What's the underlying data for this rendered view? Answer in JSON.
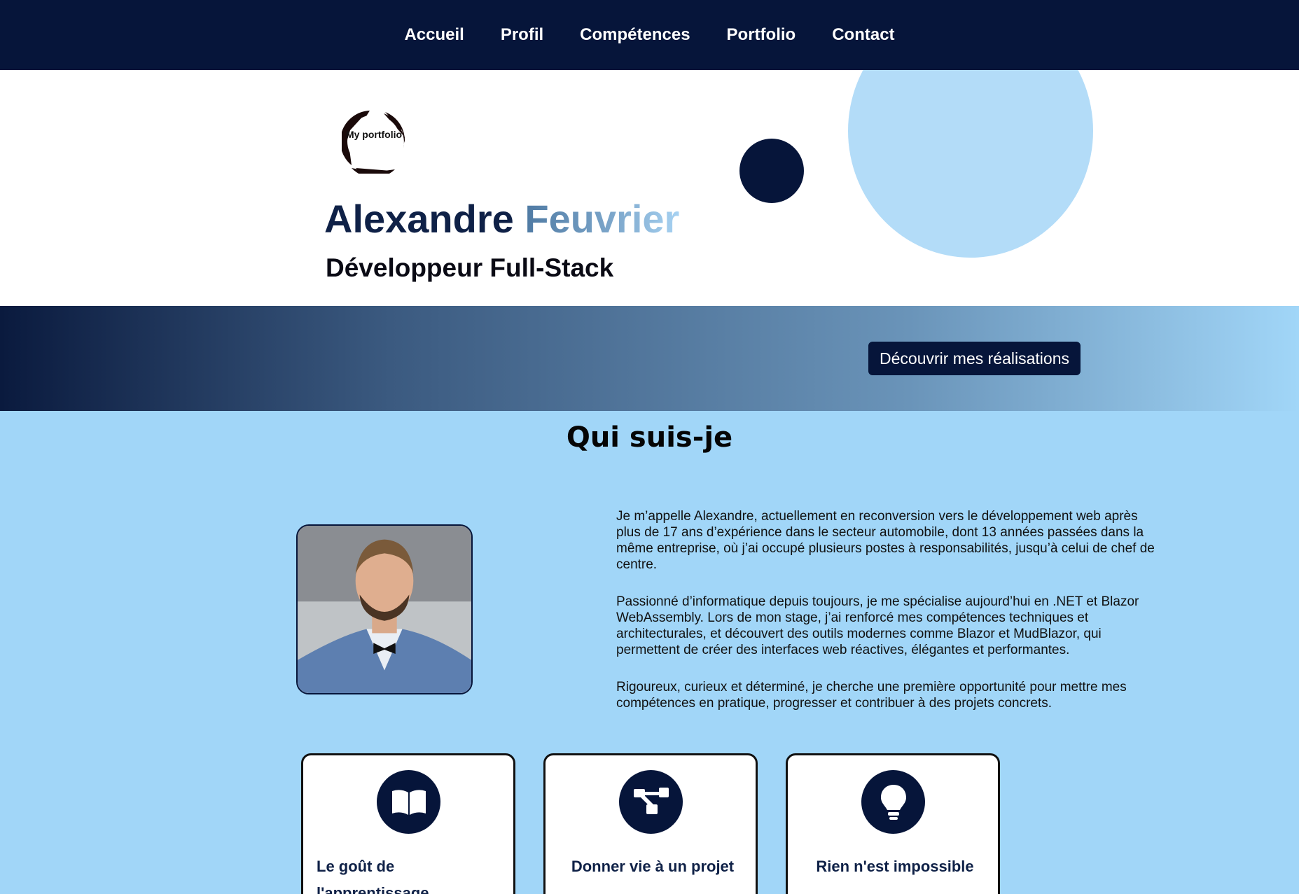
{
  "nav": {
    "items": [
      "Accueil",
      "Profil",
      "Compétences",
      "Portfolio",
      "Contact"
    ]
  },
  "hero": {
    "logo_text": "My portfolio",
    "first_name": "Alexandre",
    "last_name": "Feuvrier",
    "role": "Développeur Full-Stack"
  },
  "band": {
    "cta_label": "Découvrir mes réalisations"
  },
  "about": {
    "title": "Qui suis-je",
    "paragraphs": [
      "Je m’appelle Alexandre, actuellement en reconversion vers le développement web après plus de 17 ans d’expérience dans le secteur automobile, dont 13 années passées dans la même entreprise, où j’ai occupé plusieurs postes à responsabilités, jusqu’à celui de chef de centre.",
      "Passionné d’informatique depuis toujours, je me spécialise aujourd’hui en .NET et Blazor WebAssembly. Lors de mon stage, j’ai renforcé mes compétences techniques et architecturales, et découvert des outils modernes comme Blazor et MudBlazor, qui permettent de créer des interfaces web réactives, élégantes et performantes.",
      "Rigoureux, curieux et déterminé, je cherche une première opportunité pour mettre mes compétences en pratique, progresser et contribuer à des projets concrets."
    ]
  },
  "cards": [
    {
      "title": "Le goût de l'apprentissage",
      "icon": "book-icon"
    },
    {
      "title": "Donner vie à un projet",
      "icon": "diagram-icon"
    },
    {
      "title": "Rien n'est impossible",
      "icon": "lightbulb-icon"
    }
  ],
  "colors": {
    "navy": "#06153a",
    "sky": "#a1d6f8",
    "light_circle": "#b3dcf8"
  }
}
